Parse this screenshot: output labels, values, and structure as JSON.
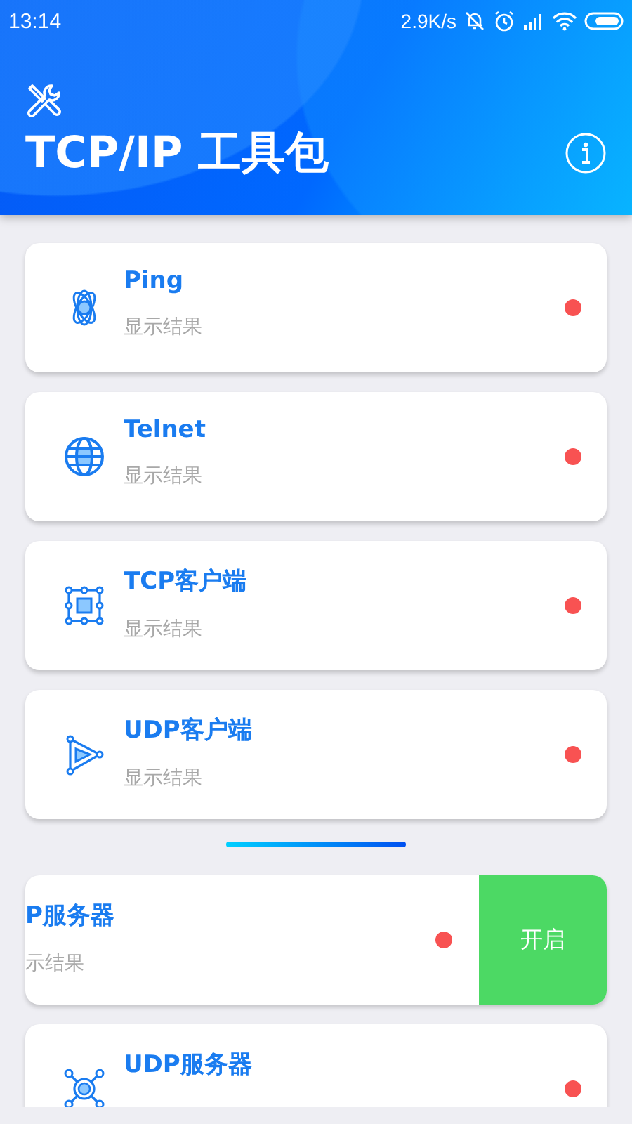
{
  "status_bar": {
    "time": "13:14",
    "speed": "2.9K/s"
  },
  "header": {
    "title": "TCP/IP 工具包"
  },
  "tools": [
    {
      "kind": "atom",
      "title": "Ping",
      "subtitle": "显示结果",
      "color": "#f85252",
      "swiped": false
    },
    {
      "kind": "globe",
      "title": "Telnet",
      "subtitle": "显示结果",
      "color": "#f85252",
      "swiped": false
    },
    {
      "kind": "frame",
      "title": "TCP客户端",
      "subtitle": "显示结果",
      "color": "#f85252",
      "swiped": false
    },
    {
      "kind": "triangle",
      "title": "UDP客户端",
      "subtitle": "显示结果",
      "color": "#f85252",
      "swiped": false
    }
  ],
  "server_tools": [
    {
      "title": "P服务器",
      "subtitle": "示结果",
      "color": "#f85252",
      "swiped": true,
      "action": "开启"
    },
    {
      "kind": "hub",
      "title": "UDP服务器",
      "color": "#f85252",
      "swiped": false
    }
  ]
}
